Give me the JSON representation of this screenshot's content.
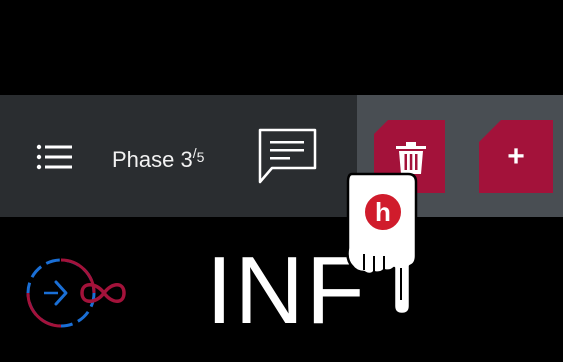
{
  "toolbar": {
    "phase": {
      "label": "Phase",
      "current": "3",
      "total": "5"
    },
    "icons": [
      "menu-icon",
      "note-icon",
      "trash-icon",
      "plus-icon"
    ],
    "add_label": "+"
  },
  "main": {
    "mode_text": "INF",
    "timer_icon": "timer-infinity-icon"
  },
  "tutorial_hand": {
    "badge_letter": "h"
  },
  "colors": {
    "background": "#000000",
    "toolbar": "#2a2d30",
    "toolbar_highlight": "#494e53",
    "accent": "#a3123a",
    "timer_blue": "#1a6fd6"
  }
}
